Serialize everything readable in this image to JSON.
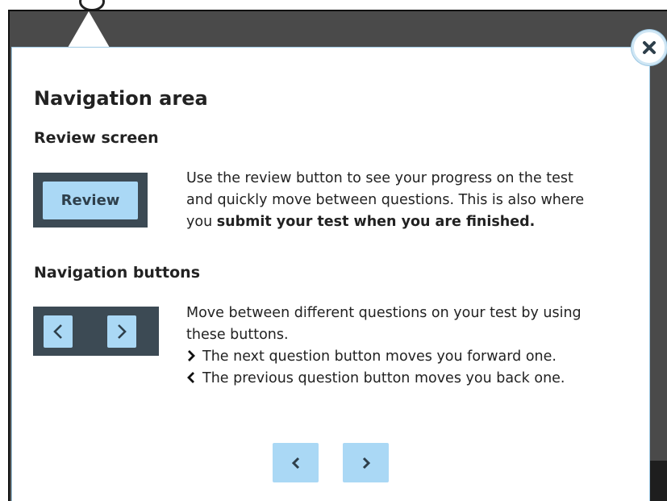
{
  "dialog": {
    "title": "Navigation area",
    "close_icon": "close-x-icon"
  },
  "review_section": {
    "heading": "Review screen",
    "demo_button_label": "Review",
    "text_line1": "Use the review button to see your progress on the test",
    "text_line2": "and quickly move between questions. This is also where",
    "text_line3_prefix": "you ",
    "text_line3_bold": "submit your test when you are finished."
  },
  "nav_section": {
    "heading": "Navigation buttons",
    "prev_icon": "chevron-left-icon",
    "next_icon": "chevron-right-icon",
    "text_line1": "Move between different questions on your test by using",
    "text_line2": "these buttons.",
    "next_desc": "The next question button moves you forward one.",
    "prev_desc": "The previous question button moves you back one."
  },
  "footer": {
    "prev_icon": "chevron-left-icon",
    "next_icon": "chevron-right-icon"
  },
  "colors": {
    "backdrop": "#4a4a4a",
    "demo_box": "#3c4a54",
    "button_fill": "#aad8f5",
    "popover_border": "#9ec9e4"
  }
}
